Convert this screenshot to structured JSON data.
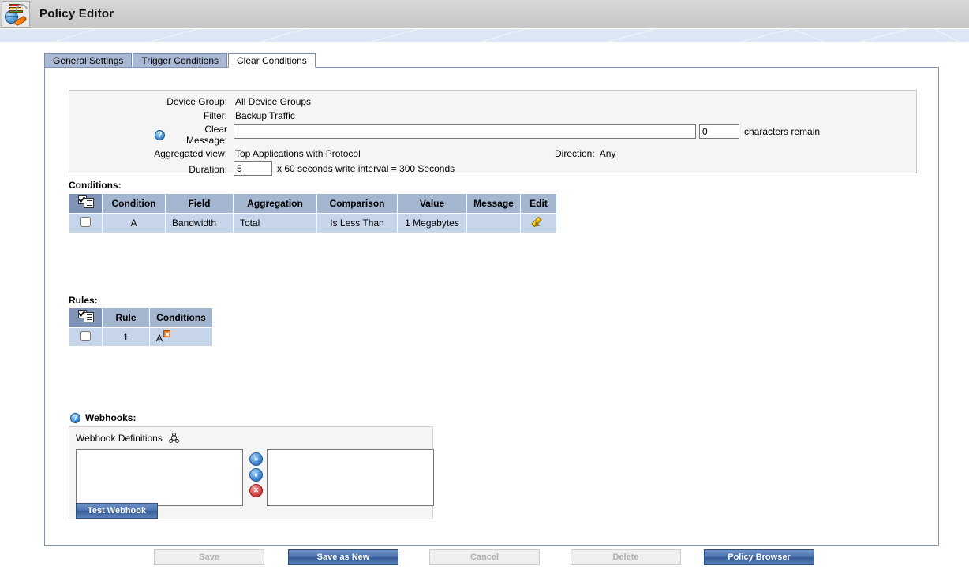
{
  "window": {
    "title": "Policy Editor",
    "app_icon": "policy-editor-icon"
  },
  "tabs": [
    {
      "label": "General Settings",
      "active": false
    },
    {
      "label": "Trigger Conditions",
      "active": false
    },
    {
      "label": "Clear Conditions",
      "active": true
    }
  ],
  "summary": {
    "device_group_label": "Device Group:",
    "device_group_value": "All Device Groups",
    "filter_label": "Filter:",
    "filter_value": "Backup Traffic",
    "clear_message_label": "Clear Message:",
    "clear_message_value": "",
    "clear_message_placeholder": "",
    "chars_value": "0",
    "chars_remain_label": "characters remain",
    "aggregated_view_label": "Aggregated view:",
    "aggregated_view_value": "Top Applications with Protocol",
    "direction_label": "Direction:",
    "direction_value": "Any",
    "duration_label": "Duration:",
    "duration_value": "5",
    "duration_suffix": "x 60 seconds write interval = 300 Seconds"
  },
  "conditions": {
    "section_label": "Conditions:",
    "columns": [
      "Condition",
      "Field",
      "Aggregation",
      "Comparison",
      "Value",
      "Message",
      "Edit"
    ],
    "rows": [
      {
        "checked": false,
        "condition": "A",
        "field": "Bandwidth",
        "aggregation": "Total",
        "comparison": "Is Less Than",
        "value": "1 Megabytes",
        "message": "",
        "edit_icon": "pencil-icon"
      }
    ]
  },
  "rules": {
    "section_label": "Rules:",
    "columns": [
      "Rule",
      "Conditions"
    ],
    "rows": [
      {
        "checked": false,
        "rule": "1",
        "conditions": "A",
        "badge": "remove-x-badge"
      }
    ]
  },
  "webhooks": {
    "section_label": "Webhooks:",
    "definitions_label": "Webhook Definitions",
    "definitions_icon": "webhook-icon",
    "available_items": [],
    "selected_items": [],
    "add_button": "»",
    "remove_button": "«",
    "delete_button": "✕",
    "test_button_label": "Test Webhook"
  },
  "footer": {
    "buttons": [
      {
        "label": "Save",
        "enabled": false
      },
      {
        "label": "Save as New",
        "enabled": true
      },
      {
        "label": "Cancel",
        "enabled": false
      },
      {
        "label": "Delete",
        "enabled": false
      },
      {
        "label": "Policy Browser",
        "enabled": true
      }
    ]
  },
  "colors": {
    "titlebar": "#cfcfcf",
    "band": "#dce7f5",
    "tab_inactive": "#a9b8d3",
    "tab_active": "#ffffff",
    "table_header": "#a3b5cf",
    "table_row": "#c6d5e9",
    "accent_button": "#4a72ad",
    "badge_orange": "#f07818"
  }
}
